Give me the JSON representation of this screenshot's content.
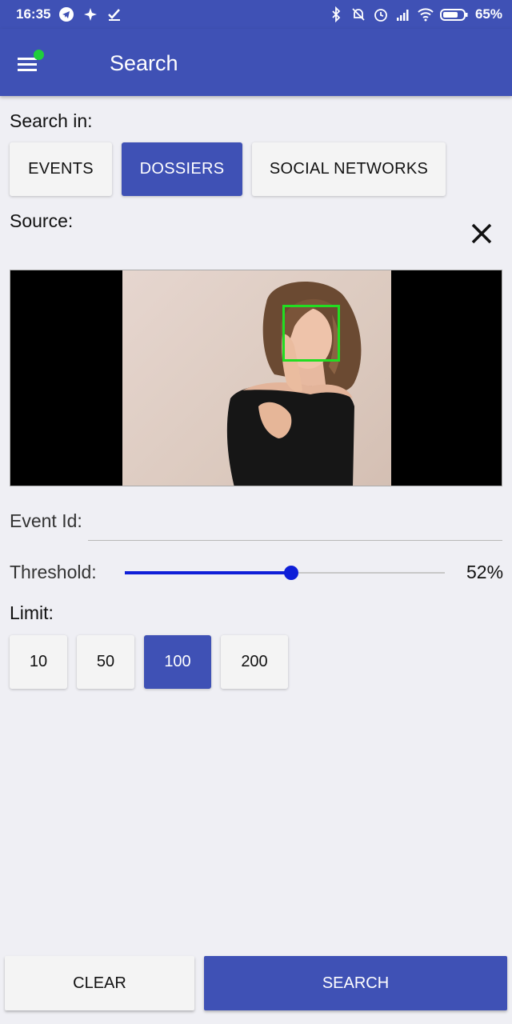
{
  "status_bar": {
    "time": "16:35",
    "battery": "65%"
  },
  "app_bar": {
    "title": "Search"
  },
  "search_in": {
    "label": "Search in:",
    "options": [
      "EVENTS",
      "DOSSIERS",
      "SOCIAL NETWORKS"
    ],
    "selected": "DOSSIERS"
  },
  "source": {
    "label": "Source:"
  },
  "event_id": {
    "label": "Event Id:",
    "value": ""
  },
  "threshold": {
    "label": "Threshold:",
    "value_text": "52%",
    "value": 52
  },
  "limit": {
    "label": "Limit:",
    "options": [
      "10",
      "50",
      "100",
      "200"
    ],
    "selected": "100"
  },
  "actions": {
    "clear_label": "CLEAR",
    "search_label": "SEARCH"
  },
  "colors": {
    "primary": "#3f51b5",
    "slider": "#0f1fd8",
    "face_box": "#22dd22",
    "notification_dot": "#1fce3c"
  }
}
